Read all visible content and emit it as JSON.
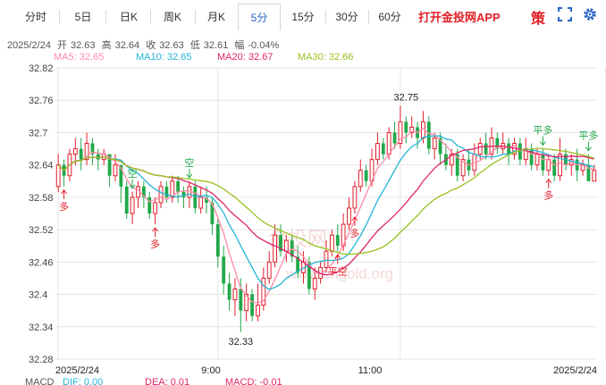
{
  "tabs": [
    {
      "label": "分时",
      "active": false
    },
    {
      "label": "5日",
      "active": false
    },
    {
      "label": "日K",
      "active": false
    },
    {
      "label": "周K",
      "active": false
    },
    {
      "label": "月K",
      "active": false
    },
    {
      "label": "5分",
      "active": true
    },
    {
      "label": "15分",
      "active": false
    },
    {
      "label": "30分",
      "active": false
    },
    {
      "label": "60分",
      "active": false
    }
  ],
  "promo_text": "打开金投网APP",
  "ce_icon_char": "策",
  "icons": [
    "expand-icon",
    "settings-gear-icon"
  ],
  "info": {
    "date": "2025/2/24",
    "open_label": "开",
    "open": "32.63",
    "high_label": "高",
    "high": "32.64",
    "close_label": "收",
    "close": "32.63",
    "low_label": "低",
    "low": "32.61",
    "change_label": "幅",
    "change": "-0.04%"
  },
  "ma_legend": [
    {
      "label": "MA5: 32.65",
      "color": "#ff8aa6"
    },
    {
      "label": "MA10: 32.65",
      "color": "#23b4d6"
    },
    {
      "label": "MA20: 32.67",
      "color": "#e0246e"
    },
    {
      "label": "MA30: 32.66",
      "color": "#97c11f"
    }
  ],
  "watermark": {
    "name": "金投网",
    "url": "www.cngold.org"
  },
  "macd_legend": [
    {
      "label": "MACD",
      "color": "#555555"
    },
    {
      "label": "DIF: 0.00",
      "color": "#23b4d6"
    },
    {
      "label": "DEA: 0.01",
      "color": "#e0246e"
    },
    {
      "label": "MACD: -0.01",
      "color": "#e0246e"
    }
  ],
  "colors": {
    "up": "#e0202a",
    "down": "#22a84a",
    "grid": "#e6e6e6"
  },
  "chart_data": {
    "type": "candlestick",
    "yticks": [
      "32.82",
      "32.76",
      "32.7",
      "32.64",
      "32.58",
      "32.52",
      "32.46",
      "32.4",
      "32.34",
      "32.28"
    ],
    "ylim": [
      32.28,
      32.82
    ],
    "xticks": [
      "2025/2/24",
      "9:00",
      "11:00",
      "2025/2/24"
    ],
    "annotations": [
      {
        "text": "32.75",
        "kind": "high",
        "bar": 61,
        "value": 32.75
      },
      {
        "text": "32.33",
        "kind": "low",
        "bar": 32,
        "value": 32.33
      }
    ],
    "signals": [
      {
        "text": "多",
        "type": "long",
        "bar": 1
      },
      {
        "text": "空",
        "type": "short",
        "bar": 13
      },
      {
        "text": "多",
        "type": "long",
        "bar": 17
      },
      {
        "text": "空",
        "type": "short",
        "bar": 23
      },
      {
        "text": "多",
        "type": "long",
        "bar": 52
      },
      {
        "text": "平空",
        "type": "close-short",
        "bar": 49
      },
      {
        "text": "平多",
        "type": "close-long",
        "bar": 85
      },
      {
        "text": "多",
        "type": "long",
        "bar": 86
      },
      {
        "text": "平多",
        "type": "close-long",
        "bar": 93
      }
    ],
    "candles": [
      [
        32.6,
        32.64,
        32.66,
        32.59
      ],
      [
        32.64,
        32.62,
        32.65,
        32.6
      ],
      [
        32.62,
        32.66,
        32.67,
        32.61
      ],
      [
        32.66,
        32.67,
        32.69,
        32.64
      ],
      [
        32.67,
        32.65,
        32.69,
        32.63
      ],
      [
        32.65,
        32.68,
        32.7,
        32.64
      ],
      [
        32.68,
        32.66,
        32.69,
        32.64
      ],
      [
        32.66,
        32.65,
        32.67,
        32.63
      ],
      [
        32.65,
        32.66,
        32.67,
        32.64
      ],
      [
        32.66,
        32.62,
        32.66,
        32.6
      ],
      [
        32.62,
        32.64,
        32.66,
        32.61
      ],
      [
        32.64,
        32.6,
        32.64,
        32.57
      ],
      [
        32.6,
        32.55,
        32.61,
        32.54
      ],
      [
        32.55,
        32.58,
        32.59,
        32.53
      ],
      [
        32.58,
        32.6,
        32.61,
        32.56
      ],
      [
        32.6,
        32.58,
        32.61,
        32.56
      ],
      [
        32.58,
        32.55,
        32.59,
        32.54
      ],
      [
        32.55,
        32.57,
        32.58,
        32.53
      ],
      [
        32.57,
        32.6,
        32.61,
        32.56
      ],
      [
        32.6,
        32.58,
        32.61,
        32.57
      ],
      [
        32.58,
        32.61,
        32.62,
        32.57
      ],
      [
        32.61,
        32.59,
        32.62,
        32.57
      ],
      [
        32.59,
        32.58,
        32.6,
        32.56
      ],
      [
        32.58,
        32.6,
        32.61,
        32.56
      ],
      [
        32.6,
        32.56,
        32.61,
        32.55
      ],
      [
        32.56,
        32.58,
        32.6,
        32.55
      ],
      [
        32.58,
        32.57,
        32.6,
        32.55
      ],
      [
        32.57,
        32.53,
        32.58,
        32.51
      ],
      [
        32.53,
        32.47,
        32.54,
        32.45
      ],
      [
        32.47,
        32.42,
        32.49,
        32.4
      ],
      [
        32.42,
        32.39,
        32.44,
        32.37
      ],
      [
        32.39,
        32.41,
        32.43,
        32.36
      ],
      [
        32.41,
        32.37,
        32.43,
        32.33
      ],
      [
        32.37,
        32.4,
        32.42,
        32.35
      ],
      [
        32.4,
        32.36,
        32.41,
        32.35
      ],
      [
        32.36,
        32.38,
        32.42,
        32.35
      ],
      [
        32.38,
        32.43,
        32.45,
        32.37
      ],
      [
        32.43,
        32.46,
        32.48,
        32.42
      ],
      [
        32.46,
        32.51,
        32.53,
        32.45
      ],
      [
        32.51,
        32.48,
        32.53,
        32.47
      ],
      [
        32.48,
        32.5,
        32.51,
        32.46
      ],
      [
        32.5,
        32.47,
        32.51,
        32.46
      ],
      [
        32.47,
        32.44,
        32.49,
        32.43
      ],
      [
        32.44,
        32.46,
        32.48,
        32.42
      ],
      [
        32.46,
        32.41,
        32.47,
        32.4
      ],
      [
        32.41,
        32.43,
        32.45,
        32.39
      ],
      [
        32.43,
        32.45,
        32.46,
        32.42
      ],
      [
        32.45,
        32.48,
        32.5,
        32.44
      ],
      [
        32.48,
        32.51,
        32.52,
        32.47
      ],
      [
        32.51,
        32.49,
        32.53,
        32.48
      ],
      [
        32.49,
        32.53,
        32.55,
        32.48
      ],
      [
        32.53,
        32.56,
        32.58,
        32.52
      ],
      [
        32.56,
        32.6,
        32.61,
        32.55
      ],
      [
        32.6,
        32.63,
        32.65,
        32.59
      ],
      [
        32.63,
        32.61,
        32.64,
        32.6
      ],
      [
        32.61,
        32.65,
        32.67,
        32.6
      ],
      [
        32.65,
        32.68,
        32.7,
        32.64
      ],
      [
        32.68,
        32.66,
        32.69,
        32.65
      ],
      [
        32.66,
        32.7,
        32.71,
        32.65
      ],
      [
        32.7,
        32.68,
        32.72,
        32.67
      ],
      [
        32.68,
        32.72,
        32.75,
        32.67
      ],
      [
        32.72,
        32.7,
        32.73,
        32.68
      ],
      [
        32.7,
        32.71,
        32.73,
        32.69
      ],
      [
        32.71,
        32.69,
        32.72,
        32.67
      ],
      [
        32.69,
        32.72,
        32.74,
        32.68
      ],
      [
        32.72,
        32.67,
        32.73,
        32.66
      ],
      [
        32.67,
        32.69,
        32.7,
        32.65
      ],
      [
        32.69,
        32.66,
        32.7,
        32.64
      ],
      [
        32.66,
        32.64,
        32.68,
        32.63
      ],
      [
        32.64,
        32.66,
        32.67,
        32.62
      ],
      [
        32.66,
        32.62,
        32.67,
        32.61
      ],
      [
        32.62,
        32.65,
        32.66,
        32.61
      ],
      [
        32.65,
        32.63,
        32.67,
        32.62
      ],
      [
        32.63,
        32.66,
        32.68,
        32.62
      ],
      [
        32.66,
        32.68,
        32.69,
        32.65
      ],
      [
        32.68,
        32.66,
        32.7,
        32.65
      ],
      [
        32.66,
        32.69,
        32.71,
        32.65
      ],
      [
        32.69,
        32.67,
        32.7,
        32.66
      ],
      [
        32.67,
        32.68,
        32.7,
        32.66
      ],
      [
        32.68,
        32.66,
        32.69,
        32.64
      ],
      [
        32.66,
        32.68,
        32.69,
        32.65
      ],
      [
        32.68,
        32.65,
        32.69,
        32.64
      ],
      [
        32.65,
        32.67,
        32.69,
        32.64
      ],
      [
        32.67,
        32.64,
        32.68,
        32.63
      ],
      [
        32.64,
        32.66,
        32.67,
        32.63
      ],
      [
        32.66,
        32.63,
        32.67,
        32.62
      ],
      [
        32.63,
        32.65,
        32.66,
        32.62
      ],
      [
        32.65,
        32.62,
        32.66,
        32.61
      ],
      [
        32.62,
        32.66,
        32.69,
        32.61
      ],
      [
        32.66,
        32.64,
        32.67,
        32.63
      ],
      [
        32.64,
        32.65,
        32.66,
        32.62
      ],
      [
        32.65,
        32.63,
        32.67,
        32.61
      ],
      [
        32.63,
        32.64,
        32.65,
        32.62
      ],
      [
        32.64,
        32.61,
        32.66,
        32.61
      ],
      [
        32.61,
        32.63,
        32.64,
        32.61
      ]
    ]
  }
}
